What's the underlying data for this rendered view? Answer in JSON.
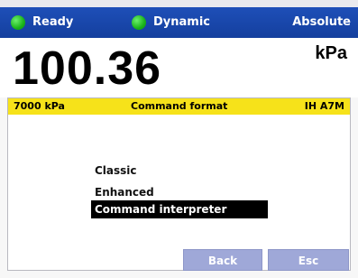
{
  "status_bar": {
    "ready_label": "Ready",
    "dynamic_label": "Dynamic",
    "absolute_label": "Absolute"
  },
  "reading": {
    "value": "100.36",
    "unit": "kPa"
  },
  "dialog": {
    "range": "7000 kPa",
    "title": "Command format",
    "code": "IH A7M",
    "options": [
      "Classic",
      "Enhanced",
      "Command interpreter"
    ],
    "selected_option": "Command interpreter",
    "buttons": {
      "back": "Back",
      "esc": "Esc"
    }
  },
  "colors": {
    "status_bar": "#1a47ad",
    "indicator": "#19b319",
    "title_bar": "#f6e21a",
    "selection": "#000000",
    "button": "#9fa8d8"
  }
}
